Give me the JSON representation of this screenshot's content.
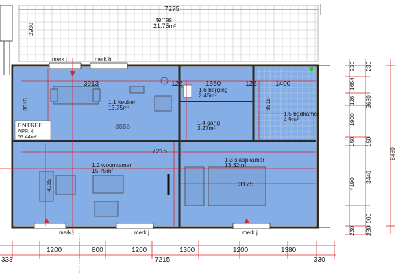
{
  "colors": {
    "room_fill": "#86aee6",
    "wall": "#2a2a2a",
    "dim_line": "#d62828",
    "grid": "#c4c4c4",
    "marker": "#d62828",
    "green_marker": "#2fbf2f"
  },
  "top": {
    "overall": "7275",
    "terras_name": "terras",
    "terras_area": "21.75m²",
    "left_height": "2930",
    "merk_left": "merk j",
    "merk_right": "merk h"
  },
  "rooms": {
    "keuken": {
      "name": "1.1 keuken",
      "area": "13.75m²",
      "dim_top": "3913",
      "dim_side": "3515"
    },
    "berging": {
      "name": "1.6 berging",
      "area": "2.45m²",
      "dim_top": "1650",
      "dim_a": "126",
      "dim_b": "126"
    },
    "gang": {
      "name": "1.4 gang",
      "area": "3.27m²"
    },
    "badkamer": {
      "name": "1.5 badkamer",
      "area": "4.9m²",
      "dim_top": "1400",
      "dim_side": "3515"
    },
    "entree": {
      "name": "ENTREE",
      "app": "APP. 4",
      "area": "53.44m²"
    },
    "woonkamer": {
      "name": "1.2 woonkamer",
      "area": "15.75m²",
      "dim_top": "7215",
      "dim_side": "4035"
    },
    "slaapkamer": {
      "name": "1.3 slaapkamer",
      "area": "13.32m²",
      "dim": "3175"
    },
    "ghost_text": "3556"
  },
  "right_dims": {
    "col1": [
      "230",
      "1654",
      "126",
      "1900",
      "150",
      "4190",
      "230"
    ],
    "col2": [
      "230",
      "3680",
      "150",
      "3440",
      "900",
      "230"
    ],
    "total": "8480"
  },
  "bottom": {
    "merk": [
      "merk j",
      "merk j",
      "merk j"
    ],
    "row1": [
      "1200",
      "800",
      "1200",
      "1300",
      "1200",
      "1380"
    ],
    "row2": [
      "333",
      "7215",
      "330"
    ]
  }
}
